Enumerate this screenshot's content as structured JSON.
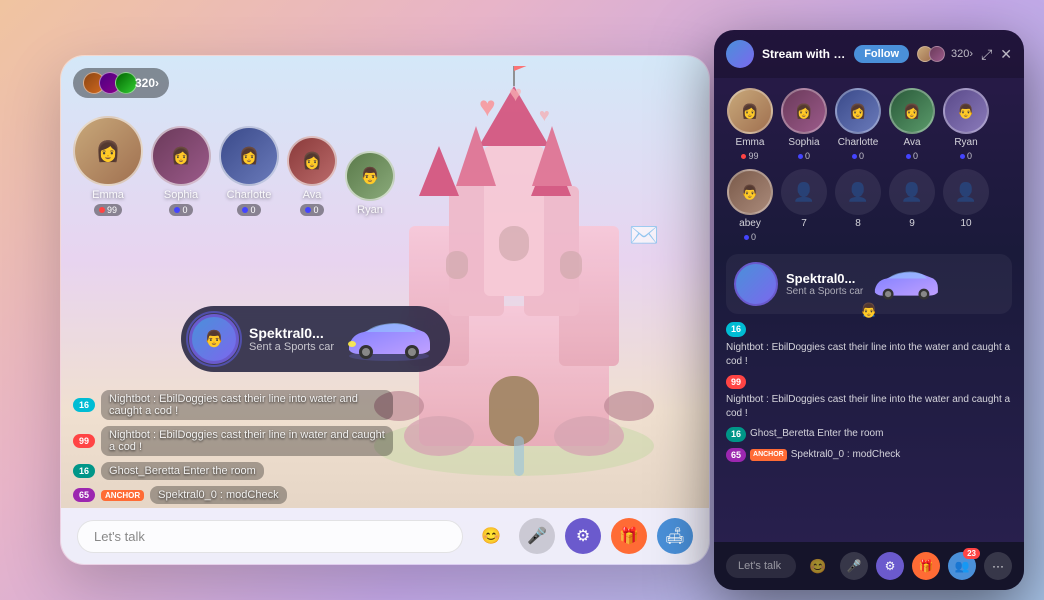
{
  "mainApp": {
    "viewerCount": "320›",
    "users": [
      {
        "name": "Emma",
        "badge": "99",
        "badgeType": "red",
        "size": "large"
      },
      {
        "name": "Sophia",
        "badge": "0",
        "badgeType": "blue",
        "size": "medium"
      },
      {
        "name": "Charlotte",
        "badge": "0",
        "badgeType": "blue",
        "size": "medium"
      },
      {
        "name": "Ava",
        "badge": "0",
        "badgeType": "blue",
        "size": "small"
      },
      {
        "name": "Ryan",
        "badge": "",
        "badgeType": "",
        "size": "small"
      }
    ],
    "giftNotification": {
      "sender": "Spektral0...",
      "message": "Sent a Sports car",
      "avatarColor": "#4A90D9"
    },
    "chatMessages": [
      {
        "badge": "16",
        "badgeType": "cyan",
        "text": "Nightbot : EbilDoggies cast their line into the water and caught a cod !"
      },
      {
        "badge": "99",
        "badgeType": "red",
        "text": "Nightbot : EbilDoggies cast their line in water and caught a cod !"
      },
      {
        "badge": "16",
        "badgeType": "teal",
        "text": "Ghost_Beretta Enter the room"
      },
      {
        "badge": "65",
        "badgeType": "purple",
        "anchor": "ANCHOR",
        "text": "Spektral0_0 : modCheck"
      }
    ],
    "input": {
      "placeholder": "Let's talk"
    },
    "toolbar": {
      "emoji": "😊",
      "mic": "🎤",
      "gear": "⚙",
      "gift": "🎁",
      "user": "🛋"
    }
  },
  "miniApp": {
    "header": {
      "title": "Stream with t...",
      "followLabel": "Follow",
      "viewerCount": "320›"
    },
    "users": [
      {
        "name": "Emma",
        "badge": "99",
        "badgeType": "red"
      },
      {
        "name": "Sophia",
        "badge": "0",
        "badgeType": "blue"
      },
      {
        "name": "Charlotte",
        "badge": "0",
        "badgeType": "blue"
      },
      {
        "name": "Ava",
        "badge": "0",
        "badgeType": "blue"
      },
      {
        "name": "Ryan",
        "badge": "0",
        "badgeType": "blue"
      }
    ],
    "row2Users": [
      {
        "name": "abey",
        "badge": "0",
        "badgeType": "blue"
      },
      {
        "name": "7",
        "isPlaceholder": true
      },
      {
        "name": "8",
        "isPlaceholder": true
      },
      {
        "name": "9",
        "isPlaceholder": true
      },
      {
        "name": "10",
        "isPlaceholder": true
      }
    ],
    "giftNotification": {
      "sender": "Spektral0...",
      "message": "Sent a Sports car"
    },
    "chatMessages": [
      {
        "badge": "16",
        "badgeType": "cyan",
        "text": "Nightbot : EbilDoggies cast their line into the water and caught a cod !"
      },
      {
        "badge": "99",
        "badgeType": "red",
        "text": "Nightbot : EbilDoggies cast their line into the water and caught a cod !"
      },
      {
        "badge": "16",
        "badgeType": "teal",
        "text": "Ghost_Beretta Enter the room"
      },
      {
        "badge": "65",
        "anchor": "ANCHOR",
        "badgeType": "purple",
        "text": "Spektral0_0 : modCheck"
      }
    ],
    "input": {
      "placeholder": "Let's talk"
    },
    "socialBadge": "23"
  }
}
